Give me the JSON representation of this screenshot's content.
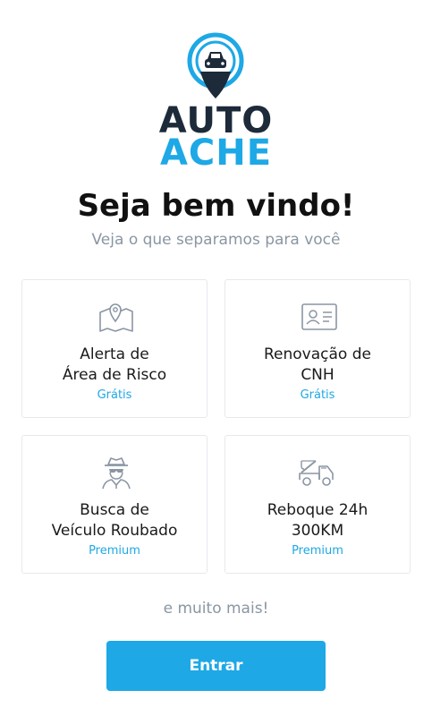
{
  "logo": {
    "line1": "AUTO",
    "line2": "ACHE",
    "icon": "location-pin-car-icon"
  },
  "header": {
    "title": "Seja bem vindo!",
    "subtitle": "Veja o que separamos para você"
  },
  "features": [
    {
      "title_line1": "Alerta de",
      "title_line2": "Área de Risco",
      "tag": "Grátis",
      "icon": "map-pin-icon"
    },
    {
      "title_line1": "Renovação de",
      "title_line2": "CNH",
      "tag": "Grátis",
      "icon": "id-card-icon"
    },
    {
      "title_line1": "Busca de",
      "title_line2": "Veículo Roubado",
      "tag": "Premium",
      "icon": "spy-agent-icon"
    },
    {
      "title_line1": "Reboque 24h",
      "title_line2": "300KM",
      "tag": "Premium",
      "icon": "tow-truck-icon"
    }
  ],
  "footer": {
    "more_text": "e muito mais!",
    "enter_label": "Entrar"
  },
  "colors": {
    "accent": "#1ea8e6",
    "dark": "#1c2a3a",
    "muted": "#8a96a3",
    "border": "#e6e9ed"
  }
}
